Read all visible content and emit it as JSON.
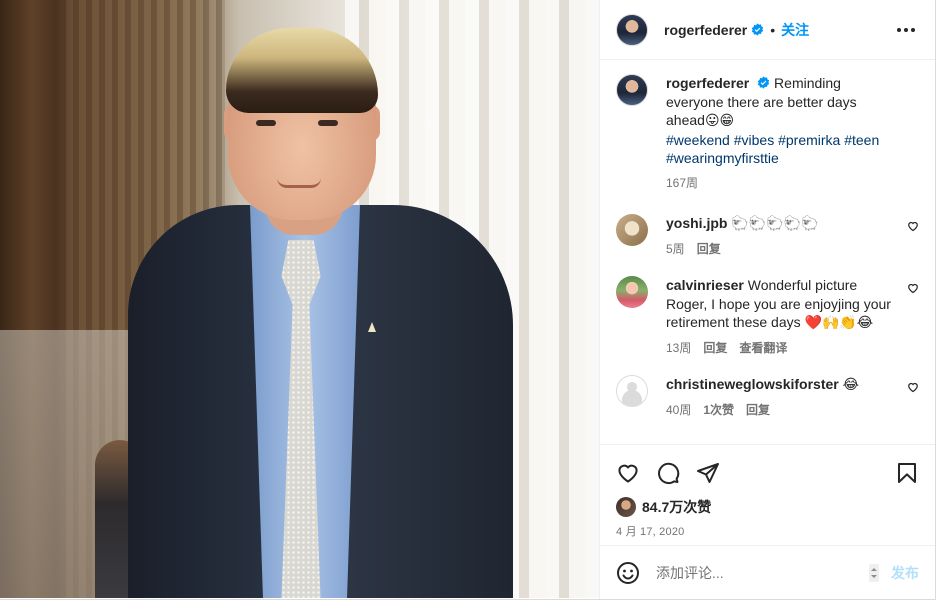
{
  "post_author": {
    "username": "rogerfederer",
    "verified_icon": "verified-badge-icon",
    "follow_label": "关注",
    "separator": "•"
  },
  "caption": {
    "username": "rogerfederer",
    "text": "Reminding everyone there are better days ahead",
    "emojis": "😛😁",
    "hashtags": [
      "#weekend",
      "#vibes",
      "#premirka",
      "#teen",
      "#wearingmyfirsttie"
    ],
    "age": "167周"
  },
  "comments": [
    {
      "username": "yoshi.jpb",
      "text": "🐑🐑🐑🐑🐑",
      "age": "5周",
      "reply_label": "回复"
    },
    {
      "username": "calvinrieser",
      "text": "Wonderful picture Roger, I hope you are enjoyjing your retirement these days",
      "emojis": "❤️🙌👏😂",
      "age": "13周",
      "reply_label": "回复",
      "translate_label": "查看翻译"
    },
    {
      "username": "christineweglowskiforster",
      "text": "😂",
      "age": "40周",
      "likes_label": "1次赞",
      "reply_label": "回复"
    }
  ],
  "actions": {
    "like_icon": "heart-icon",
    "comment_icon": "comment-bubble-icon",
    "share_icon": "paper-plane-icon",
    "save_icon": "bookmark-icon",
    "likes_count": "84.7万次赞",
    "date": "4 月 17, 2020"
  },
  "composer": {
    "emoji_icon": "smiley-icon",
    "placeholder": "添加评论...",
    "post_label": "发布"
  },
  "colors": {
    "accent": "#0095f6",
    "hashtag": "#00376b",
    "muted": "#737373",
    "post_disabled": "#b2dffc"
  }
}
